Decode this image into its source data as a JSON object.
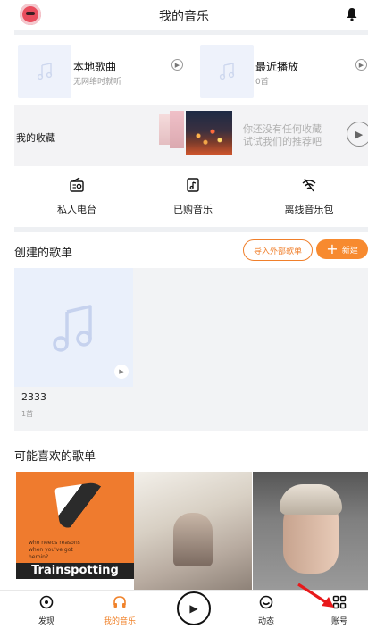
{
  "header": {
    "title": "我的音乐"
  },
  "local": {
    "title": "本地歌曲",
    "subtitle": "无网络时就听"
  },
  "recent": {
    "title": "最近播放",
    "subtitle": "0首"
  },
  "collect": {
    "label": "我的收藏",
    "msg1": "你还没有任何收藏",
    "msg2": "试试我们的推荐吧"
  },
  "quick": [
    {
      "label": "私人电台",
      "icon": "radio-icon"
    },
    {
      "label": "已购音乐",
      "icon": "purchased-icon"
    },
    {
      "label": "离线音乐包",
      "icon": "offline-wifi-icon"
    }
  ],
  "created": {
    "title": "创建的歌单",
    "import_label": "导入外部歌单",
    "new_label": "新建",
    "playlist": {
      "name": "2333",
      "count": "1首"
    }
  },
  "recommend": {
    "title": "可能喜欢的歌单",
    "card1_title": "Trainspotting",
    "card1_small": "who needs reasons when you've got heroin?"
  },
  "tabs": [
    {
      "label": "发现",
      "icon": "discover-icon"
    },
    {
      "label": "我的音乐",
      "icon": "headphones-icon"
    },
    {
      "label": "动态",
      "icon": "moments-icon"
    },
    {
      "label": "账号",
      "icon": "account-grid-icon"
    }
  ],
  "colors": {
    "accent": "#f0832c",
    "divider": "#eef0f3"
  }
}
